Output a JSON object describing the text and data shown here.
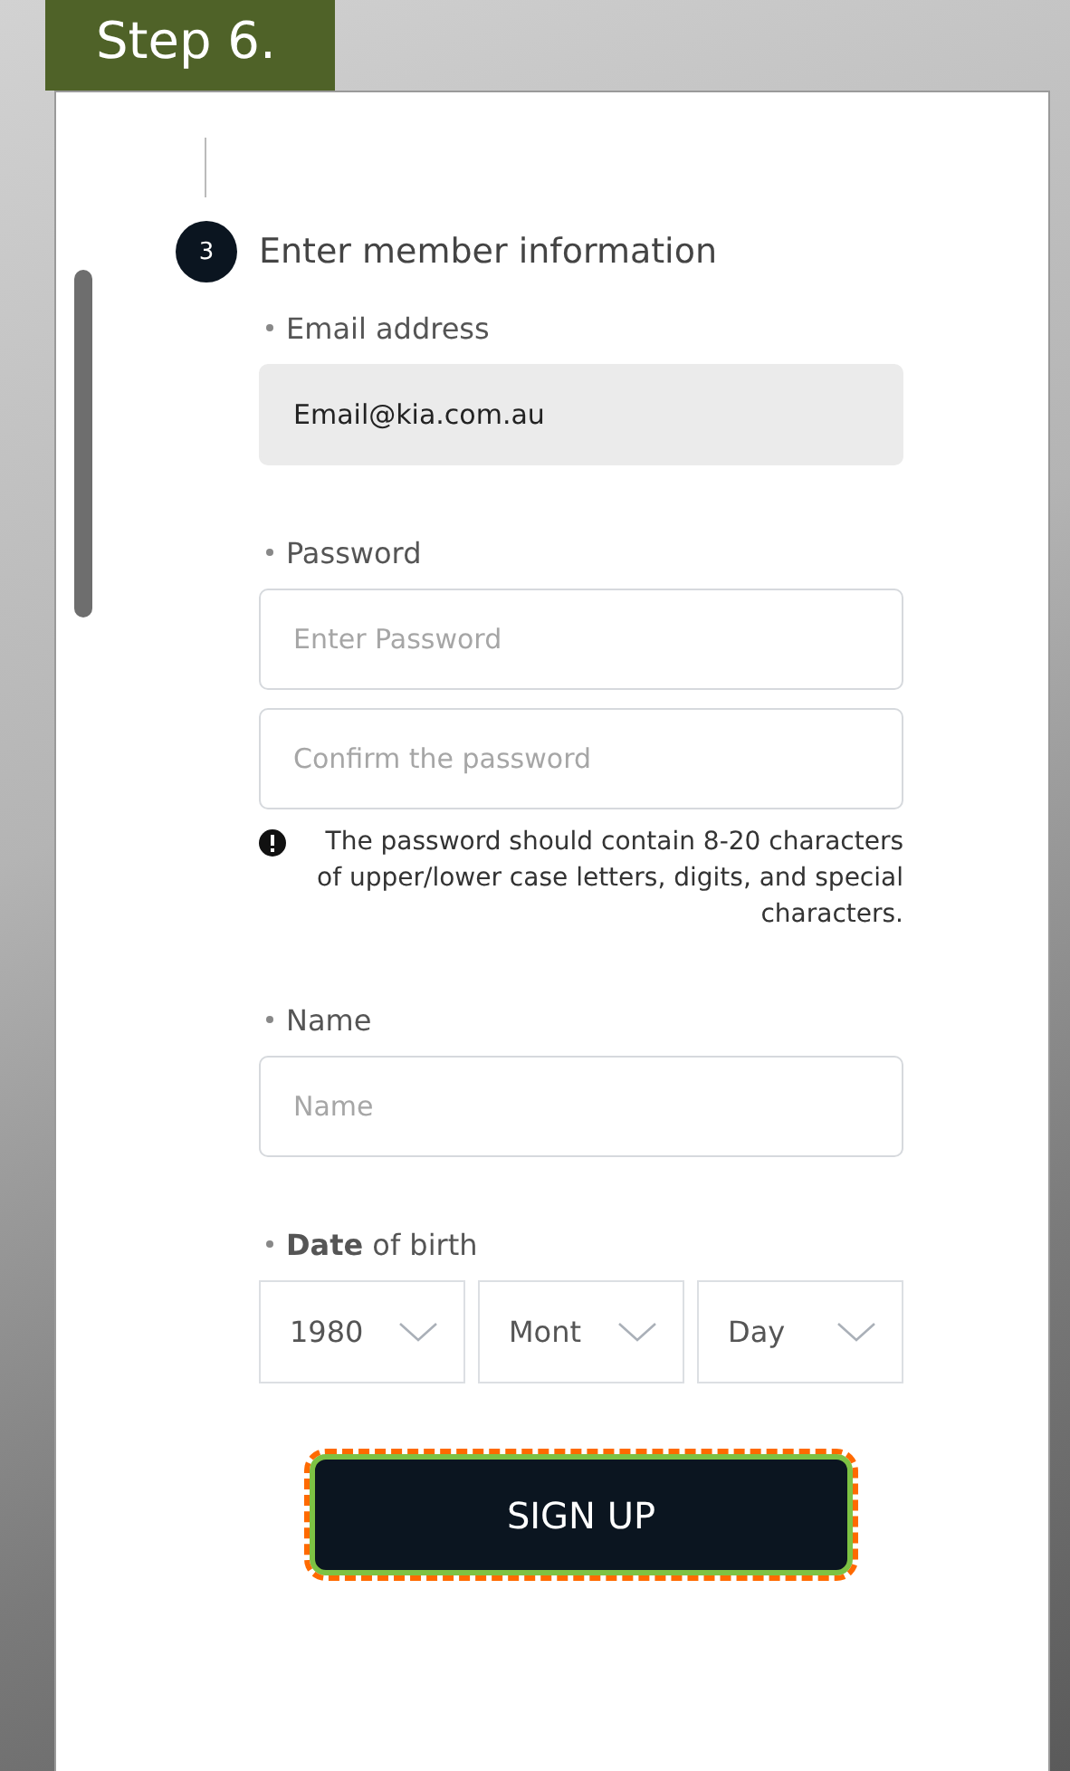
{
  "step_label": "Step 6.",
  "step": {
    "number": "3",
    "title": "Enter member information"
  },
  "sections": [
    {
      "label": "Email address",
      "inputs": [
        {
          "value": "Email@kia.com.au",
          "disabled": true
        }
      ]
    },
    {
      "label": "Password",
      "inputs": [
        {
          "placeholder": "Enter Password",
          "disabled": false
        },
        {
          "placeholder": "Confirm the password",
          "disabled": false
        }
      ],
      "note": "The password should contain 8-20 characters of upper/lower case letters, digits, and special characters."
    },
    {
      "label": "Name",
      "inputs": [
        {
          "placeholder": "Name",
          "disabled": false
        }
      ]
    },
    {
      "label": "**Date** of birth",
      "selects": [
        "1980",
        "Mont",
        "Day"
      ]
    }
  ],
  "button": {
    "label": "SIGN UP",
    "highlighted": true
  }
}
